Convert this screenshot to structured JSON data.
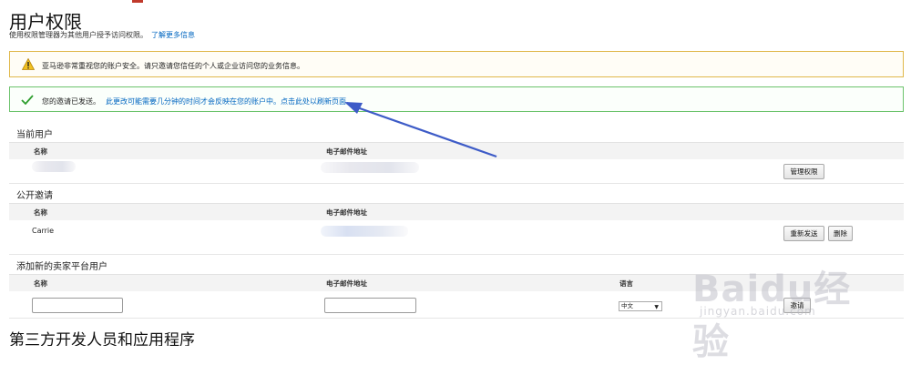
{
  "page": {
    "title": "用户权限",
    "description": "使用权限管理器为其他用户授予访问权限。",
    "learn_more": "了解更多信息"
  },
  "alerts": {
    "warning": "亚马逊非常重视您的账户安全。请只邀请您信任的个人或企业访问您的业务信息。",
    "success": "您的邀请已发送。",
    "success_link": "此更改可能需要几分钟的时间才会反映在您的账户中。点击此处以刷新页面。"
  },
  "current_users": {
    "title": "当前用户",
    "col_name": "名称",
    "col_email": "电子邮件地址",
    "manage_button": "管理权限"
  },
  "open_invites": {
    "title": "公开邀请",
    "col_name": "名称",
    "col_email": "电子邮件地址",
    "rows": [
      {
        "name": "Carrie"
      }
    ],
    "resend_button": "重新发送",
    "delete_button": "删除"
  },
  "add_user": {
    "title": "添加新的卖家平台用户",
    "col_name": "名称",
    "col_email": "电子邮件地址",
    "col_language": "语言",
    "language_value": "中文",
    "invite_button": "邀请"
  },
  "bottom_section": {
    "title": "第三方开发人员和应用程序"
  },
  "watermark": {
    "brand": "Baidu经验",
    "url": "jingyan.baidu.com"
  },
  "colors": {
    "link": "#0066c0",
    "warning_border": "#e0b84a",
    "success_border": "#6cc36c",
    "annotation_arrow": "#3d5bc7"
  }
}
